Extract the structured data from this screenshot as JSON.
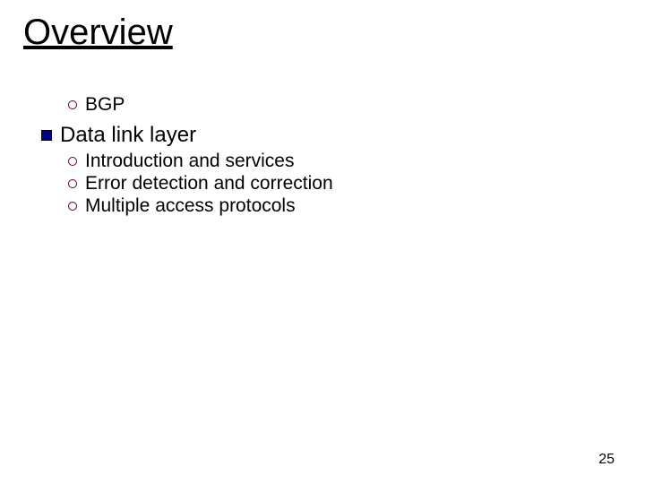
{
  "title": "Overview",
  "sections": {
    "bgp": "BGP",
    "datalink": {
      "label": "Data link layer",
      "items": {
        "intro": "Introduction and services",
        "error": "Error detection and correction",
        "multiple": "Multiple access protocols"
      }
    }
  },
  "pageNumber": "25"
}
